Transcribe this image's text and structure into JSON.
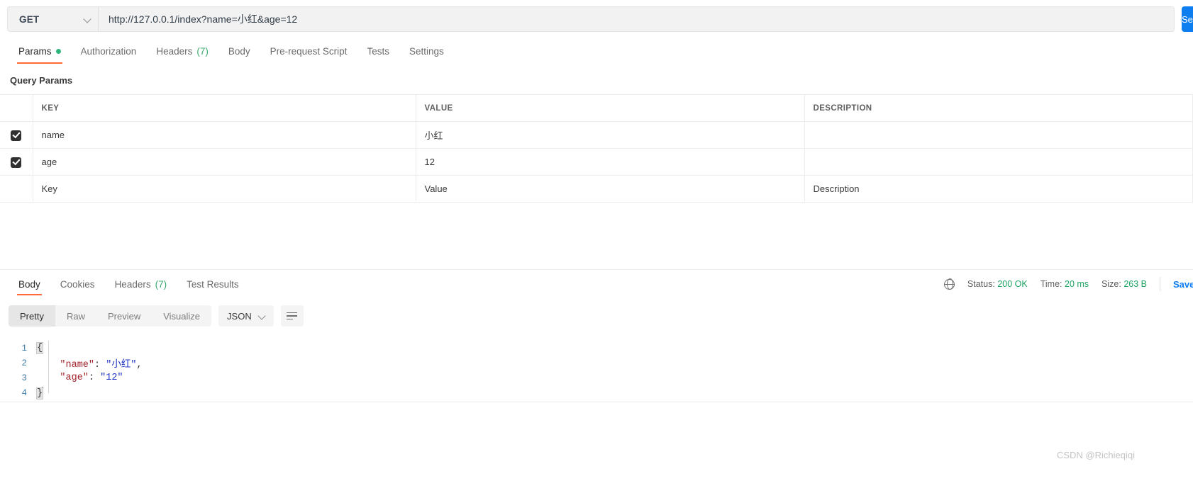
{
  "request": {
    "method": "GET",
    "url": "http://127.0.0.1/index?name=小红&age=12",
    "send_label": "Send",
    "tabs": [
      {
        "label": "Params",
        "badge": "dot",
        "active": true
      },
      {
        "label": "Authorization",
        "badge": "",
        "active": false
      },
      {
        "label": "Headers",
        "badge": "(7)",
        "active": false
      },
      {
        "label": "Body",
        "badge": "",
        "active": false
      },
      {
        "label": "Pre-request Script",
        "badge": "",
        "active": false
      },
      {
        "label": "Tests",
        "badge": "",
        "active": false
      },
      {
        "label": "Settings",
        "badge": "",
        "active": false
      }
    ]
  },
  "query_params": {
    "section_title": "Query Params",
    "columns": [
      "KEY",
      "VALUE",
      "DESCRIPTION"
    ],
    "rows": [
      {
        "checked": true,
        "key": "name",
        "value": "小红",
        "description": ""
      },
      {
        "checked": true,
        "key": "age",
        "value": "12",
        "description": ""
      }
    ],
    "placeholder_row": {
      "key": "Key",
      "value": "Value",
      "description": "Description"
    }
  },
  "response": {
    "tabs": [
      {
        "label": "Body",
        "badge": "",
        "active": true
      },
      {
        "label": "Cookies",
        "badge": "",
        "active": false
      },
      {
        "label": "Headers",
        "badge": "(7)",
        "active": false
      },
      {
        "label": "Test Results",
        "badge": "",
        "active": false
      }
    ],
    "meta": {
      "status_label": "Status:",
      "status_value": "200 OK",
      "time_label": "Time:",
      "time_value": "20 ms",
      "size_label": "Size:",
      "size_value": "263 B",
      "save_label": "Save"
    },
    "viewer": {
      "modes": [
        "Pretty",
        "Raw",
        "Preview",
        "Visualize"
      ],
      "active_mode": "Pretty",
      "format": "JSON"
    },
    "body_lines": [
      {
        "n": "1",
        "tokens": [
          {
            "t": "{",
            "c": "brace-hl"
          }
        ]
      },
      {
        "n": "2",
        "tokens": [
          {
            "t": "    ",
            "c": "tok-punct"
          },
          {
            "t": "\"name\"",
            "c": "tok-key"
          },
          {
            "t": ": ",
            "c": "tok-punct"
          },
          {
            "t": "\"小红\"",
            "c": "tok-str"
          },
          {
            "t": ",",
            "c": "tok-punct"
          }
        ]
      },
      {
        "n": "3",
        "tokens": [
          {
            "t": "    ",
            "c": "tok-punct"
          },
          {
            "t": "\"age\"",
            "c": "tok-key"
          },
          {
            "t": ": ",
            "c": "tok-punct"
          },
          {
            "t": "\"12\"",
            "c": "tok-str"
          }
        ]
      },
      {
        "n": "4",
        "tokens": [
          {
            "t": "}",
            "c": "brace-hl"
          }
        ]
      }
    ]
  },
  "watermark": "CSDN @Richieqiqi",
  "colors": {
    "accent_orange": "#ff6c37",
    "link_blue": "#0d7ef0",
    "status_green": "#1fa463"
  }
}
